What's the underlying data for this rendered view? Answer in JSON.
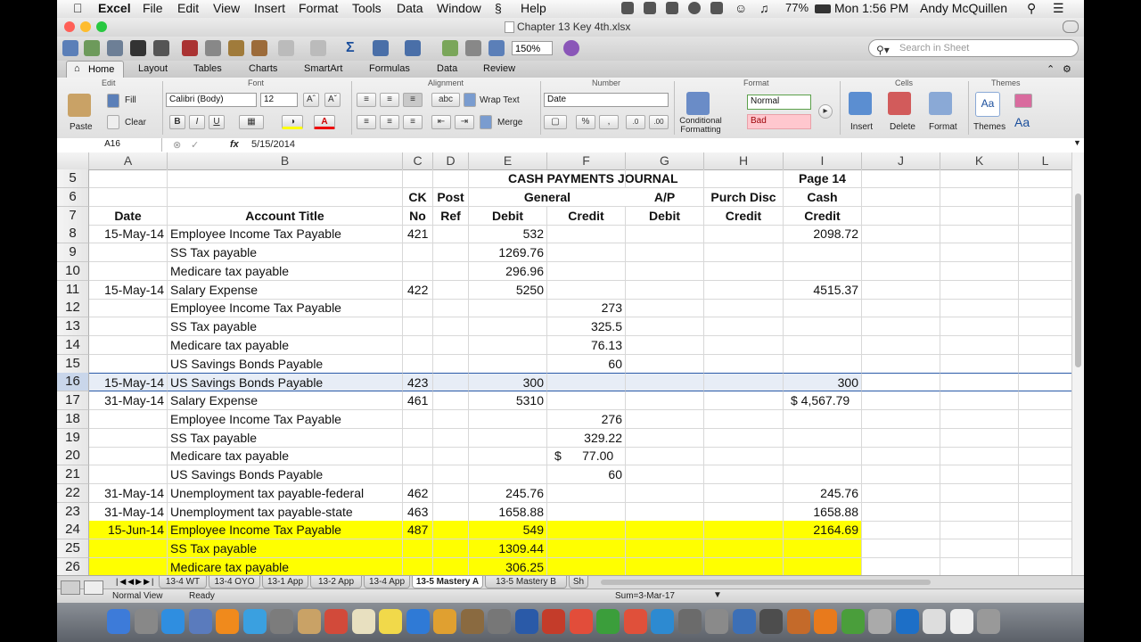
{
  "menubar": {
    "app": "Excel",
    "items": [
      "File",
      "Edit",
      "View",
      "Insert",
      "Format",
      "Tools",
      "Data",
      "Window",
      "Help"
    ],
    "battery": "77%",
    "clock": "Mon 1:56 PM",
    "user": "Andy McQuillen"
  },
  "window": {
    "title": "Chapter 13 Key 4th.xlsx"
  },
  "toolbar": {
    "zoom": "150%",
    "search_placeholder": "Search in Sheet"
  },
  "ribbon": {
    "tabs": [
      "Home",
      "Layout",
      "Tables",
      "Charts",
      "SmartArt",
      "Formulas",
      "Data",
      "Review"
    ],
    "groups": {
      "edit": "Edit",
      "font": "Font",
      "alignment": "Alignment",
      "number": "Number",
      "format": "Format",
      "cells": "Cells",
      "themes": "Themes"
    },
    "paste": "Paste",
    "fill": "Fill",
    "clear": "Clear",
    "font_name": "Calibri (Body)",
    "font_size": "12",
    "wrap_text": "Wrap Text",
    "merge": "Merge",
    "number_format": "Date",
    "conditional_formatting": "Conditional Formatting",
    "style_normal": "Normal",
    "style_bad": "Bad",
    "insert": "Insert",
    "delete": "Delete",
    "format": "Format",
    "themes": "Themes",
    "abc": "abc",
    "themes_aa": "Aa"
  },
  "formula_bar": {
    "cell_ref": "A16",
    "fx": "fx",
    "value": "5/15/2014"
  },
  "columns": [
    "A",
    "B",
    "C",
    "D",
    "E",
    "F",
    "G",
    "H",
    "I",
    "J",
    "K",
    "L"
  ],
  "rows": [
    {
      "n": "5",
      "cells": {
        "E": "CASH PAYMENTS JOURNAL",
        "I": "Page 14"
      }
    },
    {
      "n": "6",
      "cells": {
        "C": "CK",
        "D": "Post",
        "E": "General",
        "G": "A/P",
        "H": "Purch Disc",
        "I": "Cash"
      }
    },
    {
      "n": "7",
      "cells": {
        "A": "Date",
        "B": "Account Title",
        "C": "No",
        "D": "Ref",
        "E": "Debit",
        "F": "Credit",
        "G": "Debit",
        "H": "Credit",
        "I": "Credit"
      }
    },
    {
      "n": "8",
      "cells": {
        "A": "15-May-14",
        "B": "Employee Income Tax Payable",
        "C": "421",
        "E": "532",
        "I": "2098.72"
      }
    },
    {
      "n": "9",
      "cells": {
        "B": "SS Tax payable",
        "E": "1269.76"
      }
    },
    {
      "n": "10",
      "cells": {
        "B": "Medicare tax payable",
        "E": "296.96"
      }
    },
    {
      "n": "11",
      "cells": {
        "A": "15-May-14",
        "B": "Salary Expense",
        "C": "422",
        "E": "5250",
        "I": "4515.37"
      }
    },
    {
      "n": "12",
      "cells": {
        "B": "Employee Income Tax Payable",
        "F": "273"
      }
    },
    {
      "n": "13",
      "cells": {
        "B": "SS Tax payable",
        "F": "325.5"
      }
    },
    {
      "n": "14",
      "cells": {
        "B": "Medicare tax payable",
        "F": "76.13"
      }
    },
    {
      "n": "15",
      "cells": {
        "B": "US Savings Bonds Payable",
        "F": "60"
      }
    },
    {
      "n": "16",
      "cells": {
        "A": "15-May-14",
        "B": "US Savings Bonds Payable",
        "C": "423",
        "E": "300",
        "I": "300"
      }
    },
    {
      "n": "17",
      "cells": {
        "A": "31-May-14",
        "B": "Salary Expense",
        "C": "461",
        "E": "5310",
        "I": "$ 4,567.79"
      }
    },
    {
      "n": "18",
      "cells": {
        "B": "Employee Income Tax Payable",
        "F": "276"
      }
    },
    {
      "n": "19",
      "cells": {
        "B": "SS Tax payable",
        "F": "329.22"
      }
    },
    {
      "n": "20",
      "cells": {
        "B": "Medicare tax payable",
        "F": "$      77.00"
      }
    },
    {
      "n": "21",
      "cells": {
        "B": "US Savings Bonds Payable",
        "F": "60"
      }
    },
    {
      "n": "22",
      "cells": {
        "A": "31-May-14",
        "B": "Unemployment tax payable-federal",
        "C": "462",
        "E": "245.76",
        "I": "245.76"
      }
    },
    {
      "n": "23",
      "cells": {
        "A": "31-May-14",
        "B": "Unemployment tax payable-state",
        "C": "463",
        "E": "1658.88",
        "I": "1658.88"
      }
    },
    {
      "n": "24",
      "cells": {
        "A": "15-Jun-14",
        "B": "Employee Income Tax Payable",
        "C": "487",
        "E": "549",
        "I": "2164.69"
      }
    },
    {
      "n": "25",
      "cells": {
        "B": "SS Tax payable",
        "E": "1309.44"
      }
    },
    {
      "n": "26",
      "cells": {
        "B": "Medicare tax payable",
        "E": "306.25"
      }
    }
  ],
  "sheet_tabs": [
    "13-4 WT",
    "13-4 OYO",
    "13-1 App",
    "13-2 App",
    "13-4 App",
    "13-5 Mastery A",
    "13-5 Mastery B",
    "Sh"
  ],
  "active_sheet": "13-5 Mastery A",
  "status": {
    "view": "Normal View",
    "state": "Ready",
    "sum": "Sum=3-Mar-17"
  },
  "colors": {
    "highlight_yellow": "#ffff00",
    "selection": "#e7edf6",
    "style_bad_bg": "#ffc7ce"
  }
}
